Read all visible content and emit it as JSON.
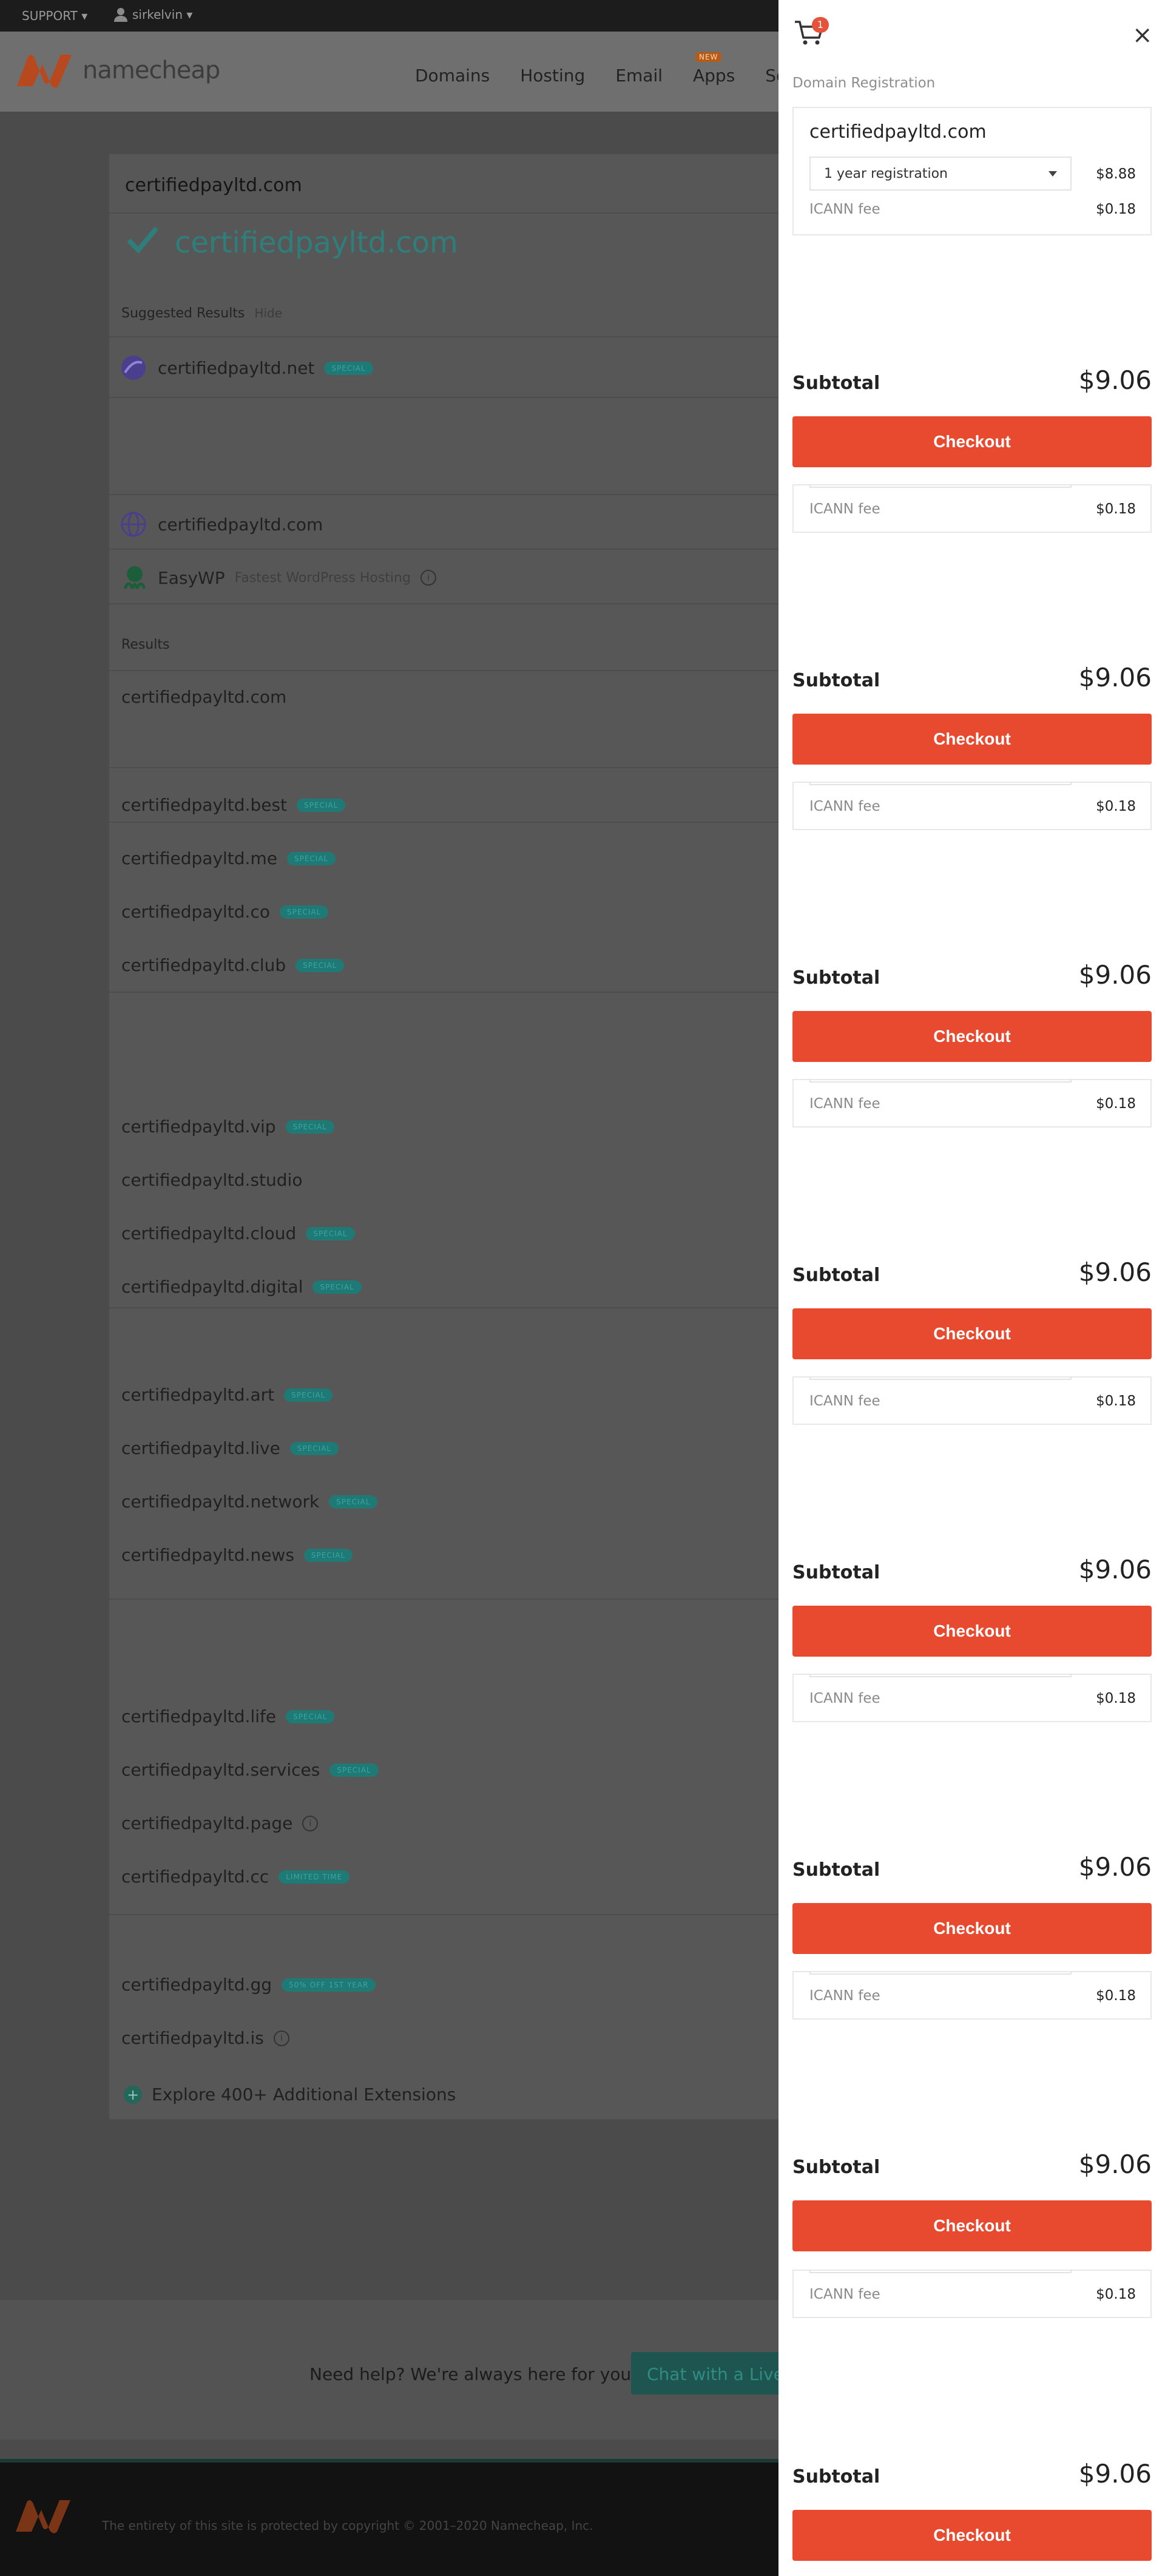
{
  "topbar": {
    "support": "SUPPORT ▾",
    "user": "sirkelvin ▾"
  },
  "header": {
    "logo_text": "namecheap",
    "nav": [
      "Domains",
      "Hosting",
      "Email",
      "Apps",
      "Secu"
    ],
    "new_badge": "NEW"
  },
  "search": {
    "query": "certifiedpayltd.com",
    "available_domain": "certifiedpayltd.com"
  },
  "suggested": {
    "heading": "Suggested Results",
    "hide": "Hide",
    "items": [
      {
        "name": "certifiedpayltd.net",
        "tag": "SPECIAL"
      },
      {
        "name": "certifiedpayltd.com"
      }
    ],
    "easywp": {
      "name": "EasyWP",
      "sub": "Fastest WordPress Hosting"
    }
  },
  "results": {
    "heading": "Results",
    "first": "certifiedpayltd.com",
    "items": [
      {
        "name": "certifiedpayltd.best",
        "tag": "SPECIAL"
      },
      {
        "name": "certifiedpayltd.me",
        "tag": "SPECIAL"
      },
      {
        "name": "certifiedpayltd.co",
        "tag": "SPECIAL"
      },
      {
        "name": "certifiedpayltd.club",
        "tag": "SPECIAL"
      },
      {
        "name": "certifiedpayltd.vip",
        "tag": "SPECIAL"
      },
      {
        "name": "certifiedpayltd.studio"
      },
      {
        "name": "certifiedpayltd.cloud",
        "tag": "SPECIAL"
      },
      {
        "name": "certifiedpayltd.digital",
        "tag": "SPECIAL"
      },
      {
        "name": "certifiedpayltd.art",
        "tag": "SPECIAL"
      },
      {
        "name": "certifiedpayltd.live",
        "tag": "SPECIAL"
      },
      {
        "name": "certifiedpayltd.network",
        "tag": "SPECIAL"
      },
      {
        "name": "certifiedpayltd.news",
        "tag": "SPECIAL"
      },
      {
        "name": "certifiedpayltd.life",
        "tag": "SPECIAL"
      },
      {
        "name": "certifiedpayltd.services",
        "tag": "SPECIAL"
      },
      {
        "name": "certifiedpayltd.page"
      },
      {
        "name": "certifiedpayltd.cc",
        "tag": "LIMITED TIME"
      },
      {
        "name": "certifiedpayltd.gg",
        "tag": "50% OFF 1ST YEAR"
      },
      {
        "name": "certifiedpayltd.is"
      }
    ],
    "explore": "Explore 400+ Additional Extensions"
  },
  "help": {
    "text": "Need help? We're always here for you.",
    "chat": "Chat with a Live Person"
  },
  "footer": {
    "copyright": "The entirety of this site is protected by copyright © 2001–2020 Namecheap, Inc."
  },
  "cart": {
    "count": "1",
    "section": "Domain Registration",
    "domain": "certifiedpayltd.com",
    "period": "1 year registration",
    "price": "$8.88",
    "icann_label": "ICANN fee",
    "icann_price": "$0.18",
    "subtotal_label": "Subtotal",
    "subtotal": "$9.06",
    "checkout": "Checkout",
    "close": "×"
  },
  "colors": {
    "accent": "#e84a2f",
    "teal": "#2e7f7c",
    "overlay": "#4b4b4b"
  }
}
